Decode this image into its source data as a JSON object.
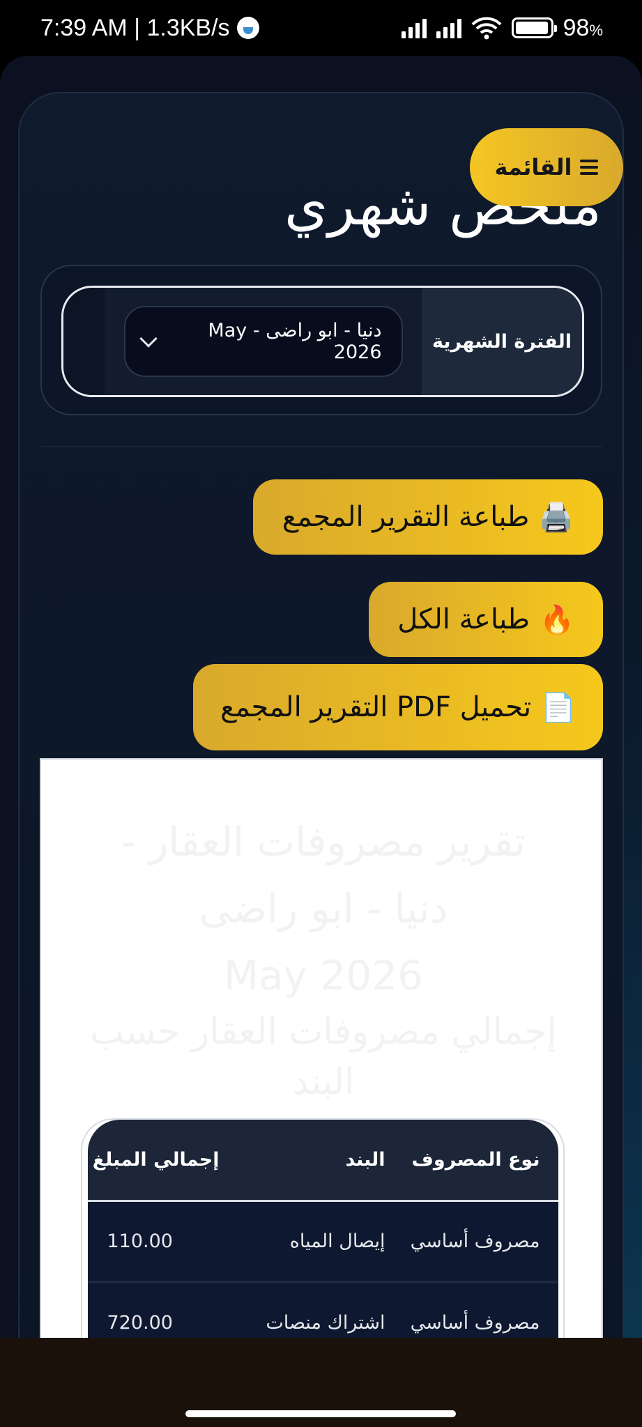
{
  "status_bar": {
    "time_speed": "7:39 AM | 1.3KB/s",
    "battery_pct": "98",
    "battery_unit": "%"
  },
  "header": {
    "menu_label": "القائمة",
    "page_title": "ملخص شهري"
  },
  "filter": {
    "label": "الفترة الشهرية",
    "selected_value": "دنيا - ابو راضى - May 2026"
  },
  "actions": {
    "print_aggregate": {
      "icon": "🖨️",
      "label": "طباعة التقرير المجمع"
    },
    "print_all": {
      "icon": "🔥",
      "label": "طباعة الكل"
    },
    "download_pdf": {
      "icon": "📄",
      "label": "تحميل PDF التقرير المجمع"
    }
  },
  "report": {
    "title_line1": "تقرير مصروفات العقار -",
    "title_line2": "دنيا - ابو راضى",
    "title_line3": "May 2026",
    "subtitle_line1": "إجمالي مصروفات العقار حسب",
    "subtitle_line2": "البند",
    "table": {
      "headers": [
        "نوع المصروف",
        "البند",
        "إجمالي المبلغ"
      ],
      "rows": [
        [
          "مصروف أساسي",
          "إيصال المياه",
          "110.00"
        ],
        [
          "مصروف أساسي",
          "اشتراك منصات",
          "720.00"
        ]
      ]
    }
  }
}
